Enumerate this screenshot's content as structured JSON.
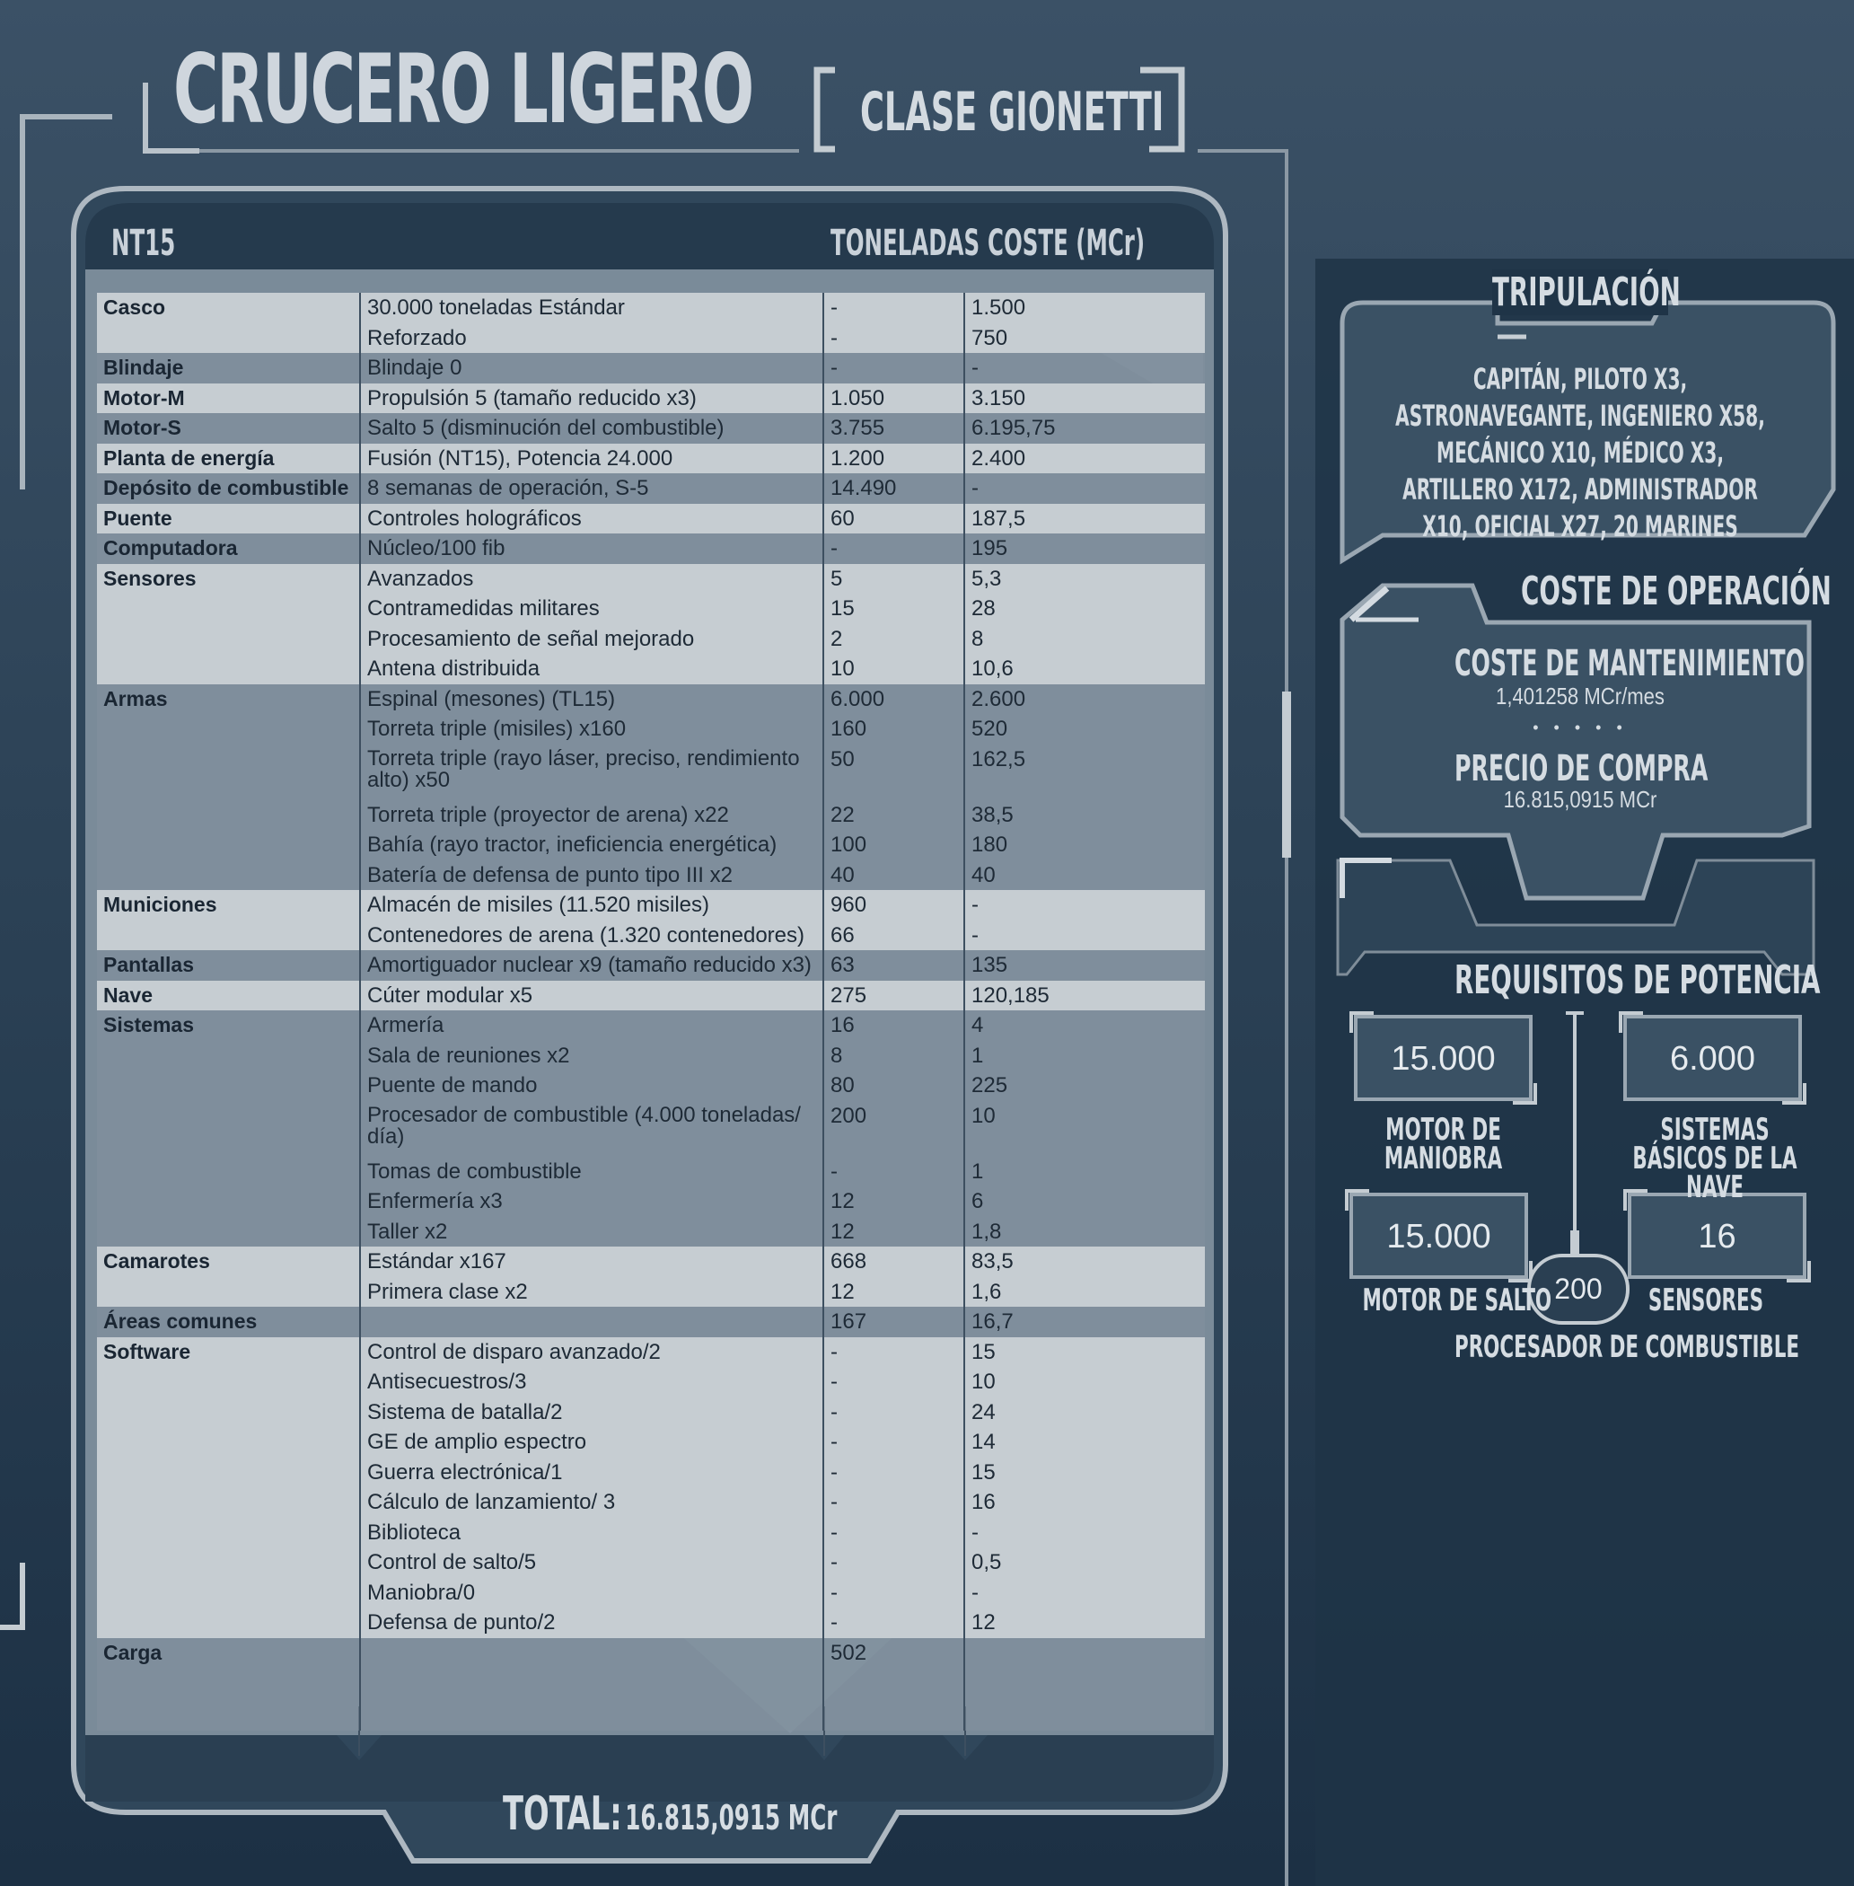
{
  "header": {
    "title": "CRUCERO LIGERO",
    "class_name": "CLASE GIONETTI"
  },
  "table": {
    "col_label": "NT15",
    "col_tons": "TONELADAS",
    "col_cost": "COSTE (MCr)",
    "rows": [
      {
        "cat": "Casco",
        "item": "30.000 toneladas Estándar",
        "tons": "-",
        "cost": "1.500",
        "shade": "l"
      },
      {
        "cat": "",
        "item": "Reforzado",
        "tons": "-",
        "cost": "750",
        "shade": "l"
      },
      {
        "cat": "Blindaje",
        "item": "Blindaje 0",
        "tons": "-",
        "cost": "-",
        "shade": "d"
      },
      {
        "cat": "Motor-M",
        "item": "Propulsión 5 (tamaño reducido x3)",
        "tons": "1.050",
        "cost": "3.150",
        "shade": "l"
      },
      {
        "cat": "Motor-S",
        "item": "Salto 5 (disminución del combustible)",
        "tons": "3.755",
        "cost": "6.195,75",
        "shade": "d"
      },
      {
        "cat": "Planta de energía",
        "item": "Fusión (NT15), Potencia 24.000",
        "tons": "1.200",
        "cost": "2.400",
        "shade": "l"
      },
      {
        "cat": "Depósito de combustible",
        "item": "8 semanas de operación, S-5",
        "tons": "14.490",
        "cost": "-",
        "shade": "d"
      },
      {
        "cat": "Puente",
        "item": "Controles holográficos",
        "tons": "60",
        "cost": "187,5",
        "shade": "l"
      },
      {
        "cat": "Computadora",
        "item": "Núcleo/100 fib",
        "tons": "-",
        "cost": "195",
        "shade": "d"
      },
      {
        "cat": "Sensores",
        "item": "Avanzados",
        "tons": "5",
        "cost": "5,3",
        "shade": "l"
      },
      {
        "cat": "",
        "item": "Contramedidas militares",
        "tons": "15",
        "cost": "28",
        "shade": "l"
      },
      {
        "cat": "",
        "item": "Procesamiento de señal mejorado",
        "tons": "2",
        "cost": "8",
        "shade": "l"
      },
      {
        "cat": "",
        "item": "Antena distribuida",
        "tons": "10",
        "cost": "10,6",
        "shade": "l"
      },
      {
        "cat": "Armas",
        "item": "Espinal (mesones) (TL15)",
        "tons": "6.000",
        "cost": "2.600",
        "shade": "d"
      },
      {
        "cat": "",
        "item": "Torreta triple (misiles) x160",
        "tons": "160",
        "cost": "520",
        "shade": "d"
      },
      {
        "cat": "",
        "item": "Torreta triple (rayo láser, preciso, rendimiento alto) x50",
        "tons": "50",
        "cost": "162,5",
        "shade": "d",
        "wrap": true
      },
      {
        "cat": "",
        "item": "Torreta triple (proyector de arena) x22",
        "tons": "22",
        "cost": "38,5",
        "shade": "d"
      },
      {
        "cat": "",
        "item": "Bahía (rayo tractor, ineficiencia energética)",
        "tons": "100",
        "cost": "180",
        "shade": "d"
      },
      {
        "cat": "",
        "item": "Batería de defensa de punto tipo III x2",
        "tons": "40",
        "cost": "40",
        "shade": "d"
      },
      {
        "cat": "Municiones",
        "item": "Almacén de misiles (11.520 misiles)",
        "tons": "960",
        "cost": "-",
        "shade": "l"
      },
      {
        "cat": "",
        "item": "Contenedores de arena (1.320 contenedores)",
        "tons": "66",
        "cost": "-",
        "shade": "l"
      },
      {
        "cat": "Pantallas",
        "item": "Amortiguador nuclear x9 (tamaño reducido x3)",
        "tons": "63",
        "cost": "135",
        "shade": "d"
      },
      {
        "cat": "Nave",
        "item": "Cúter modular x5",
        "tons": "275",
        "cost": "120,185",
        "shade": "l"
      },
      {
        "cat": "Sistemas",
        "item": "Armería",
        "tons": "16",
        "cost": "4",
        "shade": "d"
      },
      {
        "cat": "",
        "item": "Sala de reuniones x2",
        "tons": "8",
        "cost": "1",
        "shade": "d"
      },
      {
        "cat": "",
        "item": "Puente de mando",
        "tons": "80",
        "cost": "225",
        "shade": "d"
      },
      {
        "cat": "",
        "item": "Procesador de combustible (4.000 toneladas/ día)",
        "tons": "200",
        "cost": "10",
        "shade": "d",
        "wrap": true
      },
      {
        "cat": "",
        "item": "Tomas de combustible",
        "tons": "-",
        "cost": "1",
        "shade": "d"
      },
      {
        "cat": "",
        "item": "Enfermería x3",
        "tons": "12",
        "cost": "6",
        "shade": "d"
      },
      {
        "cat": "",
        "item": "Taller x2",
        "tons": "12",
        "cost": "1,8",
        "shade": "d"
      },
      {
        "cat": "Camarotes",
        "item": "Estándar x167",
        "tons": "668",
        "cost": "83,5",
        "shade": "l"
      },
      {
        "cat": "",
        "item": "Primera clase x2",
        "tons": "12",
        "cost": "1,6",
        "shade": "l"
      },
      {
        "cat": "Áreas comunes",
        "item": "",
        "tons": "167",
        "cost": "16,7",
        "shade": "d"
      },
      {
        "cat": "Software",
        "item": "Control de disparo avanzado/2",
        "tons": "-",
        "cost": "15",
        "shade": "l"
      },
      {
        "cat": "",
        "item": "Antisecuestros/3",
        "tons": "-",
        "cost": "10",
        "shade": "l"
      },
      {
        "cat": "",
        "item": "Sistema de batalla/2",
        "tons": "-",
        "cost": "24",
        "shade": "l"
      },
      {
        "cat": "",
        "item": "GE de amplio espectro",
        "tons": "-",
        "cost": "14",
        "shade": "l"
      },
      {
        "cat": "",
        "item": "Guerra electrónica/1",
        "tons": "-",
        "cost": "15",
        "shade": "l"
      },
      {
        "cat": "",
        "item": "Cálculo de lanzamiento/ 3",
        "tons": "-",
        "cost": "16",
        "shade": "l"
      },
      {
        "cat": "",
        "item": "Biblioteca",
        "tons": "-",
        "cost": "-",
        "shade": "l"
      },
      {
        "cat": "",
        "item": "Control de salto/5",
        "tons": "-",
        "cost": "0,5",
        "shade": "l"
      },
      {
        "cat": "",
        "item": "Maniobra/0",
        "tons": "-",
        "cost": "-",
        "shade": "l"
      },
      {
        "cat": "",
        "item": "Defensa de punto/2",
        "tons": "-",
        "cost": "12",
        "shade": "l"
      },
      {
        "cat": "Carga",
        "item": "",
        "tons": "502",
        "cost": "",
        "shade": "d"
      }
    ]
  },
  "total": {
    "label": "TOTAL:",
    "value": "16.815,0915 MCr"
  },
  "crew": {
    "title": "TRIPULACIÓN",
    "text": "CAPITÁN, PILOTO X3, ASTRONAVEGANTE, INGENIERO X58, MECÁNICO X10, MÉDICO X3, ARTILLERO X172, ADMINISTRADOR X10, OFICIAL X27, 20 MARINES"
  },
  "operating_cost": {
    "title": "COSTE DE OPERACIÓN",
    "maintenance_label": "COSTE DE MANTENIMIENTO",
    "maintenance_value": "1,401258 MCr/mes",
    "separator": "• • • • •",
    "purchase_label": "PRECIO DE COMPRA",
    "purchase_value": "16.815,0915 MCr"
  },
  "power": {
    "title": "REQUISITOS DE POTENCIA",
    "maneuver_value": "15.000",
    "maneuver_label": "MOTOR DE MANIOBRA",
    "basic_value": "6.000",
    "basic_label": "SISTEMAS BÁSICOS DE LA NAVE",
    "jump_value": "15.000",
    "jump_label": "MOTOR DE SALTO",
    "sensors_value": "16",
    "sensors_label": "SENSORES",
    "fuel_value": "200",
    "fuel_label": "PROCESADOR DE COMBUSTIBLE"
  }
}
